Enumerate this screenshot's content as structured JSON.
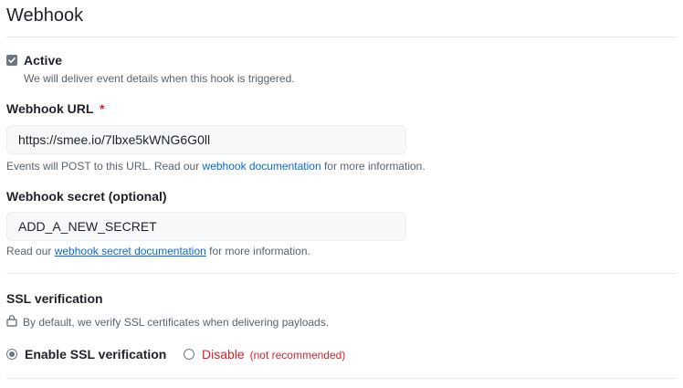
{
  "header": {
    "title": "Webhook"
  },
  "active": {
    "label": "Active",
    "checked": true,
    "help": "We will deliver event details when this hook is triggered."
  },
  "webhook_url": {
    "label": "Webhook URL",
    "required_mark": "*",
    "value": "https://smee.io/7lbxe5kWNG6G0ll",
    "help_prefix": "Events will POST to this URL. Read our ",
    "help_link": "webhook documentation",
    "help_suffix": " for more information."
  },
  "webhook_secret": {
    "label": "Webhook secret (optional)",
    "value": "ADD_A_NEW_SECRET",
    "help_prefix": "Read our ",
    "help_link": "webhook secret documentation",
    "help_suffix": " for more information."
  },
  "ssl": {
    "label": "SSL verification",
    "help": "By default, we verify SSL certificates when delivering payloads.",
    "enable_label": "Enable SSL verification",
    "disable_label": "Disable",
    "disable_note": "(not recommended)",
    "selected": "enable"
  },
  "colors": {
    "link": "#0969da",
    "danger": "#d1242f",
    "muted": "#59636e"
  }
}
